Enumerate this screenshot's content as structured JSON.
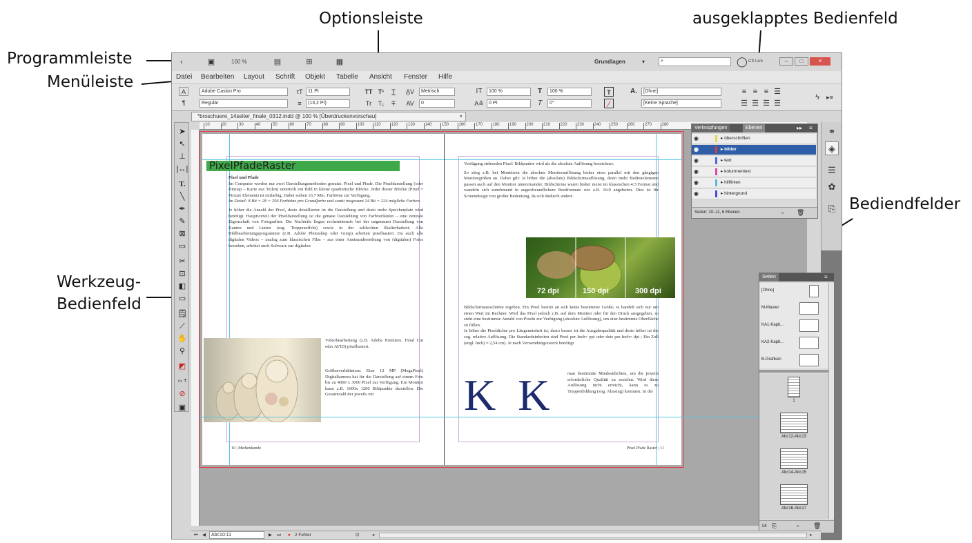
{
  "callouts": {
    "optionsleiste": "Optionsleiste",
    "ausgeklappt": "ausgeklapptes Bedienfeld",
    "programmleiste": "Programmleiste",
    "menuleiste": "Menüleiste",
    "bediendfelder": "Bediendfelder",
    "werkzeug1": "Werkzeug-",
    "werkzeug2": "Bedienfeld"
  },
  "appbar": {
    "zoom": "100 %",
    "workspace": "Grundlagen",
    "cslive": "CS Live"
  },
  "menu": [
    "Datei",
    "Bearbeiten",
    "Layout",
    "Schrift",
    "Objekt",
    "Tabelle",
    "Ansicht",
    "Fenster",
    "Hilfe"
  ],
  "options": {
    "font": "Adobe Caslon Pro",
    "style": "Regular",
    "size": "11 Pt",
    "leading": "(13,2 Pt)",
    "language_lbl": "Metrisch",
    "kern": "0",
    "scale_v": "100 %",
    "scale_h": "100 %",
    "baseline": "0 Pt",
    "skew": "0°",
    "charstyle": "[Ohne]",
    "lang": "[Keine Sprache]"
  },
  "doc_tab": "*broschuere_14seiter_finale_0312.indd @ 100 % [Überdruckenvorschau]",
  "ruler_ticks": [
    "10",
    "20",
    "30",
    "40",
    "50",
    "60",
    "70",
    "80",
    "90",
    "100",
    "110",
    "120",
    "130",
    "140",
    "150",
    "160",
    "170",
    "180",
    "190",
    "200",
    "210",
    "220",
    "230",
    "240",
    "250",
    "260",
    "270",
    "280"
  ],
  "left_page": {
    "heading": "PixelPfadeRaster",
    "subheading": "Pixel und Pfade",
    "p1": "Im Computer werden nur zwei Darstellungsmethoden genutzt: Pixel und Pfade. Die Pixeldarstellung (oder Bitmap – Karte aus Teilen) unterteilt ein Bild in kleine quadratische Blöcke. Jeder dieser Blöcke (Pixel = Picture Element) ist einfarbig. Dabei stehen 16,7 Mio. Farbtöne zur Verfügung.",
    "p1_italic": "Im Detail: 8 Bit = 28 = 256 Farbtöne pro Grundfarbe und somit insgesamt 24 Bit = 224 mögliche Farben.",
    "p2": "Je höher die Anzahl der Pixel, desto detaillierter ist die Darstellung und desto mehr Speicherplatz wird benötigt. Hauptvorteil der Pixeldarstellung ist die genaue Darstellung von Farbverläufen – eine zentrale Eigenschaft von Fotografien. Die Nachteile liegen rechenintensiv bei der ungenauen Darstellung von Kanten und Linien (sog. Treppeneffekt) sowie in der schlechten Skalierbarkeit. Alle Bildbearbeitungsprogramme (z.B. Adobe Photoshop oder Gimp) arbeiten pixelbasiert. Da auch alle digitalen Videos – analog zum klassischen Film – aus einer Aneinanderreihung von (digitalen) Fotos bestehen, arbeitet auch Software zur digitalen",
    "p3": "Videobearbeitung (z.B. Adobe Premiere, Final Cut oder AVID) pixelbasiert.",
    "p4": "Größenverhältnisse: Eine 12 MP (MegaPixel) Digitalkamera hat für die Darstellung auf einem Foto bis zu 4000 x 3000 Pixel zur Verfügung. Ein Monitor kann z.B. 1600x 1200 Bildpunkte darstellen. Die Gesamtzahl der jeweils zur",
    "footer": "10  |  Medienkunde"
  },
  "right_page": {
    "p1": "Verfügung stehenden Pixel/ Bildpunkte wird als die absolute Auflösung bezeichnet.",
    "p2": "So stieg z.B. bei Monitoren die absolute Monitorauflösung bisher etwa parallel mit den gängigen Monitorgrößen an. Dabei gilt: Je höher die (absolute) Bildschirmauflösung, desto mehr Bedienelemente passen auch auf den Monitor untereinander. Bildschirme waren bisher meist im klassischen 4:3 Format und wandeln sich zunehmend in augenfreundlichere Breitformate wie z.B. 16:9 angeboten. Dies ist für Screendesign von großer Bedeutung, da sich dadurch andere",
    "dpi": [
      "72 dpi",
      "150 dpi",
      "300 dpi"
    ],
    "p3": "Bildschirmausschnitte ergeben. Ein Pixel besitzt an sich keine bestimmte Größe; es handelt sich nur um einen Wert im Rechner. Wird das Pixel jedoch z.B. auf dem Monitor oder für den Druck ausgegeben, so steht eine bestimmte Anzahl von Pixeln zur Verfügung (absolute Auflösung), um eine bestimmte Oberfläche zu füllen.",
    "p4": "Je höher die Pixeldichte pro Längeneinheit ist, desto besser ist die Ausgabequalität und desto höher ist die sog. relative Auflösung. Die Standardeinheiten sind Pixel per Inch= ppi oder dots per Inch= dpi ; Ein Zoll (engl. Inch) ≈ 2,54 cm). Je nach Verwendungszweck benötigt",
    "p5": "man bestimmte Mindestdichten, um die jeweils erforderliche Qualität zu erzielen. Wird diese Auflösung nicht erreicht, kann es zu Treppenbildung (sog. Aliasing) kommen. In der",
    "kk": "K  K",
    "footer": "Pixel Pfade Raster   |  11"
  },
  "layers_panel": {
    "tabs": [
      "Verknüpfungen",
      "Ebenen"
    ],
    "rows": [
      "überschriften",
      "bilder",
      "text",
      "kolumnentext",
      "hilflinien",
      "hintergrund"
    ],
    "footer": "Seiten: 10–11, 6 Ebenen"
  },
  "pages_panel": {
    "tab": "Seiten",
    "masters": [
      "[Ohne]",
      "M-Master",
      "KA1-Kapit...",
      "KA2-Kapit...",
      "B-Grafiken"
    ],
    "spreads": [
      "1",
      "Abc12-Abc13",
      "Abc14-Abc15",
      "Abc16-Abc17"
    ],
    "count": "14"
  },
  "status": {
    "page": "Abc10:11",
    "errors": "2 Fehler"
  },
  "colors": {
    "heading_green": "#3fa94a",
    "kk_blue": "#1d2a6b",
    "margin_magenta": "#e05ab8",
    "bleed_red": "#e0404a",
    "guide_cyan": "#58c6e0"
  }
}
